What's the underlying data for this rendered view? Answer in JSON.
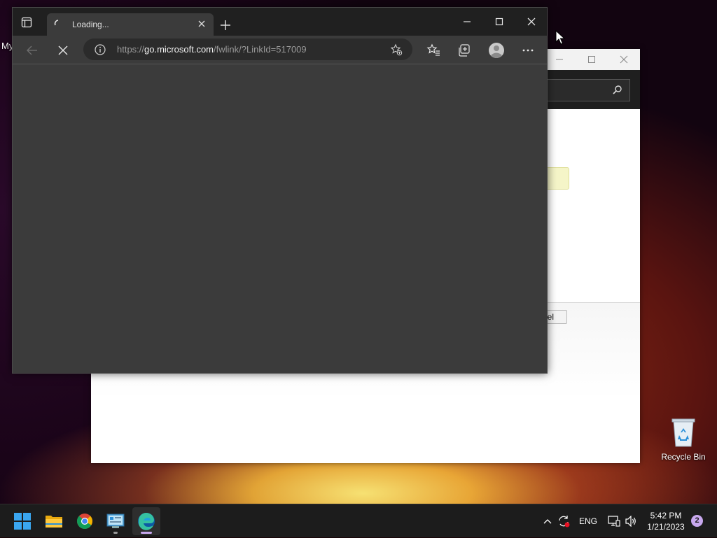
{
  "desktop": {
    "partial_icon_label": "My",
    "recycle_bin_label": "Recycle Bin"
  },
  "background_window": {
    "cancel_button_partial": "el",
    "icons": [
      "minimize-icon",
      "maximize-icon",
      "close-icon",
      "search-icon"
    ]
  },
  "browser": {
    "tab_title": "Loading...",
    "address": {
      "scheme": "https://",
      "host": "go.microsoft.com",
      "path": "/fwlink/?LinkId=517009"
    },
    "icons": [
      "tab-actions-icon",
      "loading-spinner-icon",
      "tab-close-icon",
      "new-tab-icon",
      "minimize-icon",
      "maximize-icon",
      "close-icon",
      "back-icon",
      "stop-loading-icon",
      "site-info-icon",
      "add-favorite-icon",
      "favorites-icon",
      "collections-icon",
      "profile-icon",
      "more-icon"
    ]
  },
  "taskbar": {
    "apps": [
      "start-button",
      "file-explorer",
      "chrome",
      "control-panel",
      "edge"
    ],
    "language": "ENG",
    "time": "5:42 PM",
    "date": "1/21/2023",
    "notification_count": "2"
  }
}
